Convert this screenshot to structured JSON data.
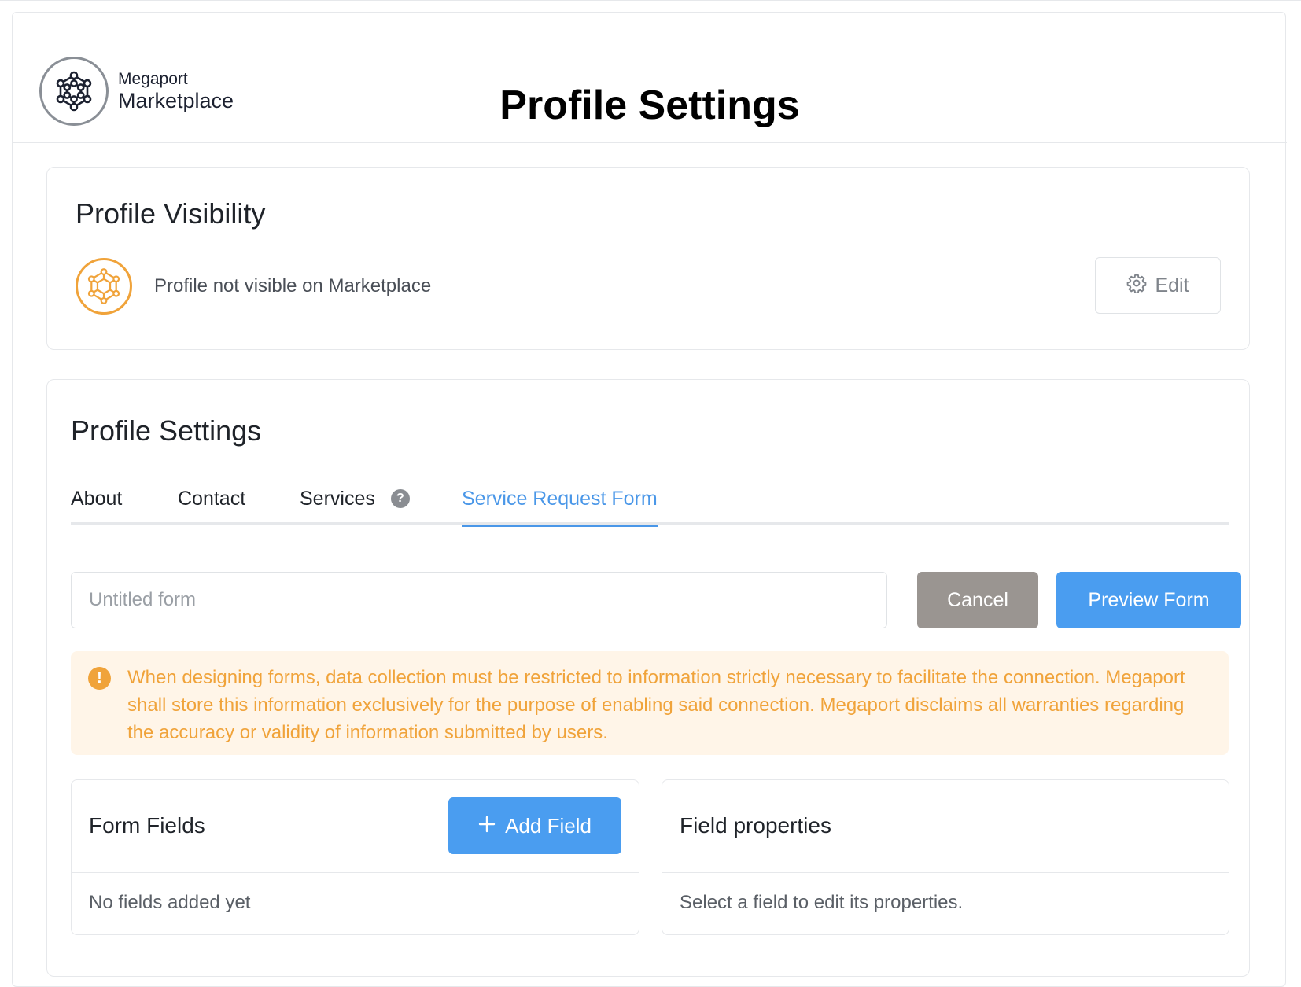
{
  "brand": {
    "line1": "Megaport",
    "line2": "Marketplace"
  },
  "header": {
    "title": "Profile Settings"
  },
  "visibility": {
    "title": "Profile Visibility",
    "status": "Profile not visible on Marketplace",
    "edit_label": "Edit"
  },
  "settings": {
    "title": "Profile Settings",
    "tabs": [
      {
        "label": "About",
        "active": false
      },
      {
        "label": "Contact",
        "active": false
      },
      {
        "label": "Services",
        "active": false,
        "help": "?"
      },
      {
        "label": "Service Request Form",
        "active": true
      }
    ],
    "form_name": {
      "value": "",
      "placeholder": "Untitled form"
    },
    "cancel_label": "Cancel",
    "preview_label": "Preview Form",
    "notice": {
      "icon": "!",
      "text": "When designing forms, data collection must be restricted to information strictly necessary to facilitate the connection. Megaport shall store this information exclusively for the purpose of enabling said connection. Megaport disclaims all warranties regarding the accuracy or validity of information submitted by users."
    },
    "form_fields": {
      "title": "Form Fields",
      "add_label": "Add Field",
      "empty": "No fields added yet"
    },
    "field_properties": {
      "title": "Field properties",
      "empty": "Select a field to edit its properties."
    }
  },
  "colors": {
    "accent": "#4a9df0",
    "warning": "#f0a33a",
    "warning_bg": "#fff5e8",
    "cancel": "#9a9591"
  }
}
